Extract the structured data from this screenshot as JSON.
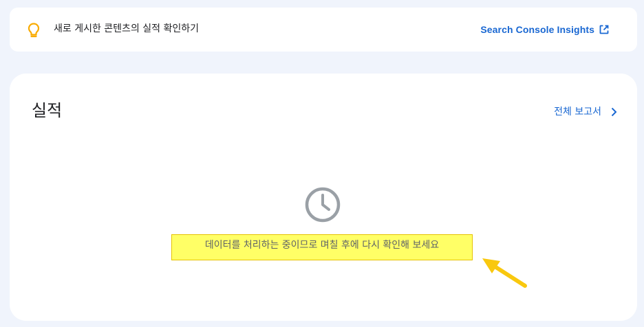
{
  "insights_banner": {
    "message": "새로 게시한 콘텐츠의 실적 확인하기",
    "link_label": "Search Console Insights"
  },
  "performance": {
    "title": "실적",
    "full_report_label": "전체 보고서",
    "processing_message": "데이터를 처리하는 중이므로 며칠 후에 다시 확인해 보세요"
  },
  "colors": {
    "accent": "#1967d2",
    "bulb": "#f9ab00",
    "highlight": "#ffff66",
    "arrow": "#f9c80e",
    "background": "#f0f4fc"
  }
}
